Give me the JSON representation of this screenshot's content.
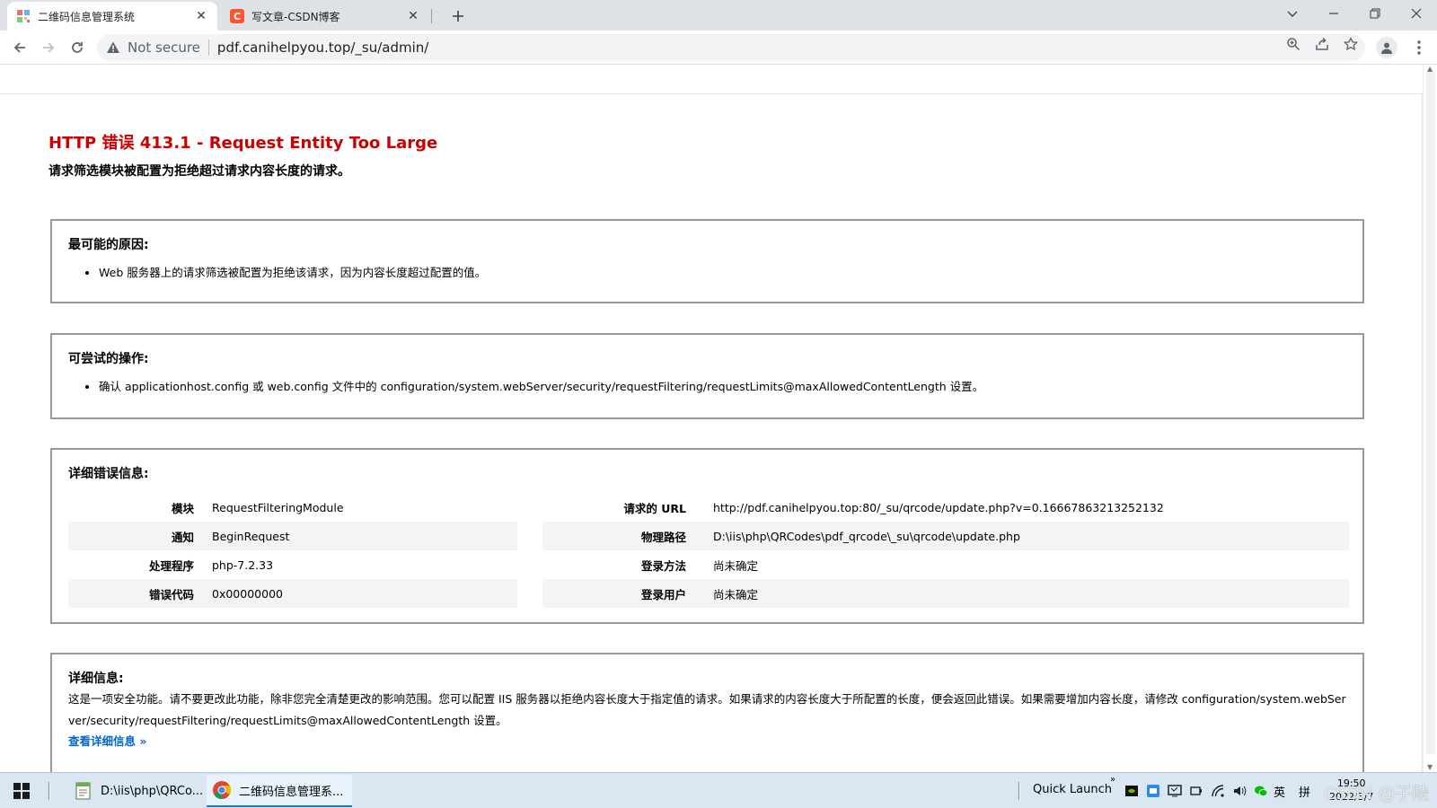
{
  "browser": {
    "tabs": [
      {
        "title": "二维码信息管理系统",
        "active": true
      },
      {
        "title": "写文章-CSDN博客",
        "active": false
      }
    ],
    "address": {
      "security_label": "Not secure",
      "url": "pdf.canihelpyou.top/_su/admin/"
    }
  },
  "page": {
    "title": "HTTP 错误 413.1 - Request Entity Too Large",
    "subtitle": "请求筛选模块被配置为拒绝超过请求内容长度的请求。",
    "cause": {
      "heading": "最可能的原因:",
      "items": [
        "Web 服务器上的请求筛选被配置为拒绝该请求，因为内容长度超过配置的值。"
      ]
    },
    "actions": {
      "heading": "可尝试的操作:",
      "items": [
        "确认 applicationhost.config 或 web.config 文件中的 configuration/system.webServer/security/requestFiltering/requestLimits@maxAllowedContentLength 设置。"
      ]
    },
    "details": {
      "heading": "详细错误信息:",
      "left": [
        {
          "label": "模块",
          "value": "RequestFilteringModule"
        },
        {
          "label": "通知",
          "value": "BeginRequest"
        },
        {
          "label": "处理程序",
          "value": "php-7.2.33"
        },
        {
          "label": "错误代码",
          "value": "0x00000000"
        }
      ],
      "right": [
        {
          "label": "请求的 URL",
          "value": "http://pdf.canihelpyou.top:80/_su/qrcode/update.php?v=0.16667863213252132"
        },
        {
          "label": "物理路径",
          "value": "D:\\iis\\php\\QRCodes\\pdf_qrcode\\_su\\qrcode\\update.php"
        },
        {
          "label": "登录方法",
          "value": "尚未确定"
        },
        {
          "label": "登录用户",
          "value": "尚未确定"
        }
      ]
    },
    "more_info": {
      "heading": "详细信息:",
      "text": "这是一项安全功能。请不要更改此功能，除非您完全清楚更改的影响范围。您可以配置 IIS 服务器以拒绝内容长度大于指定值的请求。如果请求的内容长度大于所配置的长度，便会返回此错误。如果需要增加内容长度，请修改 configuration/system.webServer/security/requestFiltering/requestLimits@maxAllowedContentLength 设置。",
      "link": "查看详细信息 »"
    }
  },
  "taskbar": {
    "items": [
      {
        "label": "D:\\iis\\php\\QRCo..."
      },
      {
        "label": "二维码信息管理系..."
      }
    ],
    "quick_launch": "Quick Launch",
    "ime_lang": "英",
    "ime_mode": "拼",
    "time": "19:50",
    "date": "2022/3/7",
    "watermark": "CSDN @子陵"
  },
  "colors": {
    "error_title": "#cc0000",
    "link": "#0066cc",
    "box_border": "#999999"
  }
}
